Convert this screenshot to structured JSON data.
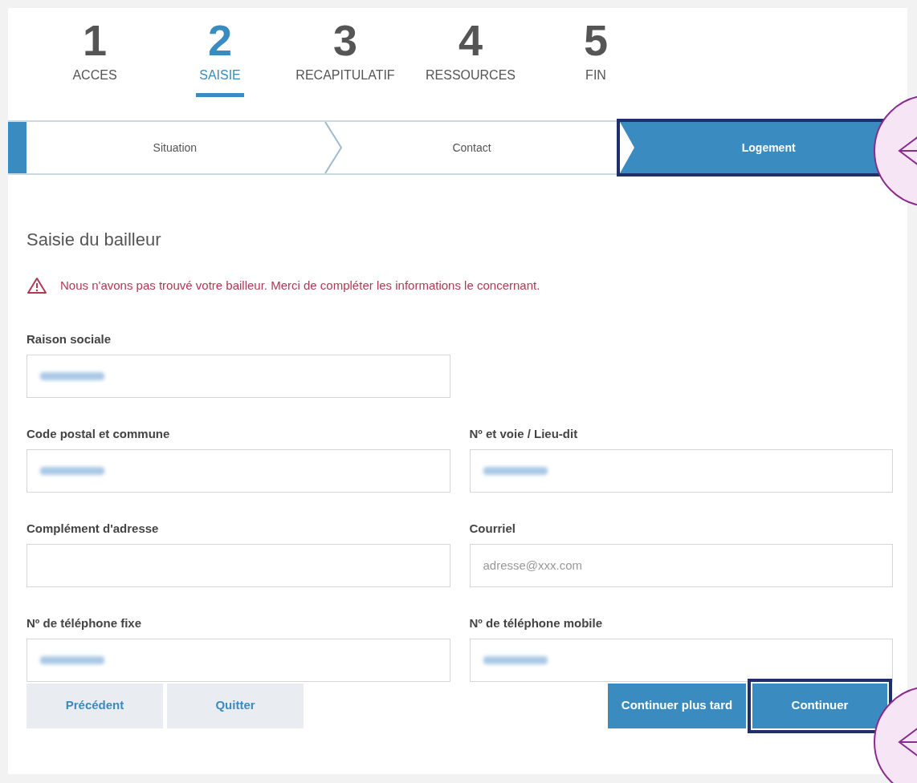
{
  "steps": [
    {
      "number": "1",
      "label": "ACCES",
      "selected": false
    },
    {
      "number": "2",
      "label": "SAISIE",
      "selected": true
    },
    {
      "number": "3",
      "label": "RECAPITULATIF",
      "selected": false
    },
    {
      "number": "4",
      "label": "RESSOURCES",
      "selected": false
    },
    {
      "number": "5",
      "label": "FIN",
      "selected": false
    }
  ],
  "substeps": [
    {
      "label": "Situation",
      "selected": false,
      "highlighted": false
    },
    {
      "label": "Contact",
      "selected": false,
      "highlighted": false
    },
    {
      "label": "Logement",
      "selected": true,
      "highlighted": true
    }
  ],
  "heading": "Saisie du bailleur",
  "warning": "Nous n'avons pas trouvé votre bailleur. Merci de compléter les informations le concernant.",
  "form_rows": [
    [
      {
        "label": "Raison sociale",
        "redacted": true
      }
    ],
    [
      {
        "label": "Code postal et commune",
        "redacted": true
      },
      {
        "label": "Nº et voie / Lieu-dit",
        "redacted": true
      }
    ],
    [
      {
        "label": "Complément d'adresse",
        "redacted": false
      },
      {
        "label": "Courriel",
        "placeholder": "adresse@xxx.com"
      }
    ],
    [
      {
        "label": "Nº de téléphone fixe",
        "redacted": true
      },
      {
        "label": "Nº de téléphone mobile",
        "redacted": true
      }
    ]
  ],
  "buttons_left": [
    {
      "label": "Précédent",
      "kind": "secondary",
      "highlighted": false
    },
    {
      "label": "Quitter",
      "kind": "secondary",
      "highlighted": false
    }
  ],
  "buttons_right": [
    {
      "label": "Continuer plus tard",
      "kind": "primary",
      "highlighted": false
    },
    {
      "label": "Continuer",
      "kind": "primary",
      "highlighted": true
    }
  ]
}
